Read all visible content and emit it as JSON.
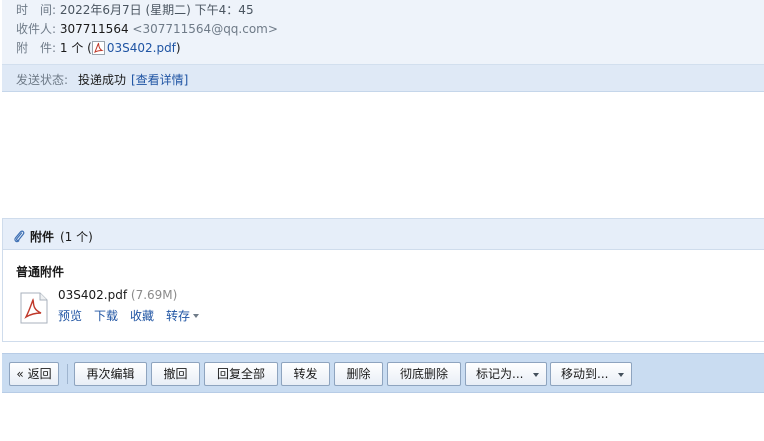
{
  "header": {
    "time_label": "时　间:",
    "time_value": "2022年6月7日 (星期二) 下午4：45",
    "recipient_label": "收件人:",
    "recipient_name": "307711564",
    "recipient_email": "<307711564@qq.com>",
    "attachment_label": "附　件:",
    "attachment_count": "1 个",
    "attachment_open_paren": "(",
    "attachment_filename": "03S402.pdf",
    "attachment_close_paren": ")"
  },
  "status": {
    "label": "发送状态:",
    "value": "投递成功",
    "detail_link": "[查看详情]"
  },
  "attachments": {
    "title": "附件",
    "count": "(1 个)",
    "section_label": "普通附件",
    "file": {
      "name": "03S402.pdf",
      "size": "(7.69M)",
      "actions": {
        "preview": "预览",
        "download": "下载",
        "favorite": "收藏",
        "save_to": "转存"
      }
    }
  },
  "toolbar": {
    "back": "« 返回",
    "edit_again": "再次编辑",
    "recall": "撤回",
    "reply_all": "回复全部",
    "forward": "转发",
    "delete": "删除",
    "delete_permanent": "彻底删除",
    "mark_as": "标记为...",
    "move_to": "移动到..."
  },
  "colors": {
    "accent_link": "#1f54a3",
    "toolbar_bg": "#c9dcf1",
    "header_bg": "#eef3fa",
    "pdf_red": "#c0392b"
  },
  "icons": {
    "attachment_icon": "paperclip-icon",
    "file_icon": "pdf-file-icon"
  }
}
